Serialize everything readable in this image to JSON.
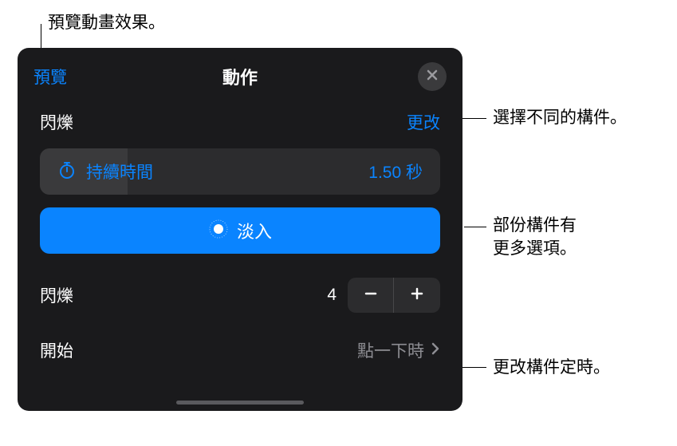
{
  "callouts": {
    "preview": "預覽動畫效果。",
    "change": "選擇不同的構件。",
    "fade_options_l1": "部份構件有",
    "fade_options_l2": "更多選項。",
    "timing": "更改構件定時。"
  },
  "header": {
    "preview_label": "預覽",
    "title": "動作"
  },
  "section": {
    "effect_name": "閃爍",
    "change_label": "更改"
  },
  "duration": {
    "label": "持續時間",
    "value": "1.50 秒"
  },
  "fade": {
    "label": "淡入"
  },
  "stepper": {
    "label": "閃爍",
    "value": "4"
  },
  "start": {
    "label": "開始",
    "value": "點一下時"
  }
}
